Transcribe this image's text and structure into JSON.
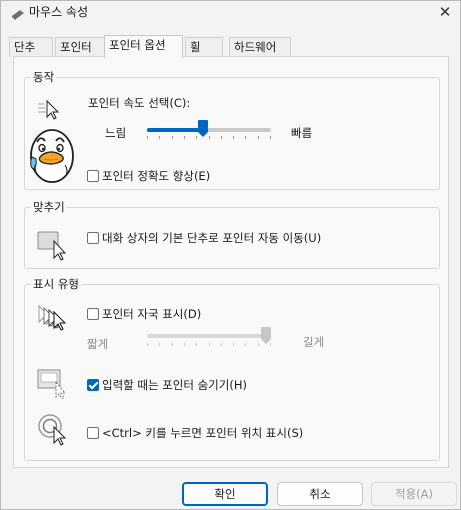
{
  "window": {
    "title": "마우스 속성"
  },
  "tabs": [
    {
      "label": "단추"
    },
    {
      "label": "포인터"
    },
    {
      "label": "포인터 옵션"
    },
    {
      "label": "휠"
    },
    {
      "label": "하드웨어"
    }
  ],
  "motion": {
    "group_label": "동작",
    "speed_label": "포인터 속도 선택(C):",
    "slow_label": "느림",
    "fast_label": "빠름",
    "speed_value": 0.45,
    "precision_label": "포인터 정확도 향상(E)",
    "precision_checked": false
  },
  "snap_to": {
    "group_label": "맞추기",
    "snap_label": "대화 상자의 기본 단추로 포인터 자동 이동(U)",
    "snap_checked": false
  },
  "visibility": {
    "group_label": "표시 유형",
    "trails_label": "포인터 자국 표시(D)",
    "trails_checked": false,
    "short_label": "짧게",
    "long_label": "길게",
    "trail_length": 1.0,
    "hide_typing_label": "입력할 때는 포인터 숨기기(H)",
    "hide_typing_checked": true,
    "ctrl_label": "<Ctrl> 키를 누르면 포인터 위치 표시(S)",
    "ctrl_checked": false
  },
  "buttons": {
    "ok": "확인",
    "cancel": "취소",
    "apply": "적용(A)"
  },
  "colors": {
    "accent": "#0067c0"
  },
  "icons": {
    "window": "mouse-icon",
    "close": "close-icon",
    "speed": "pointer-speed-icon",
    "mascot": "duck-mascot-sticker",
    "snap": "snap-to-button-icon",
    "trails": "pointer-trails-icon",
    "hide": "hide-pointer-typing-icon",
    "locate": "locate-pointer-icon"
  }
}
